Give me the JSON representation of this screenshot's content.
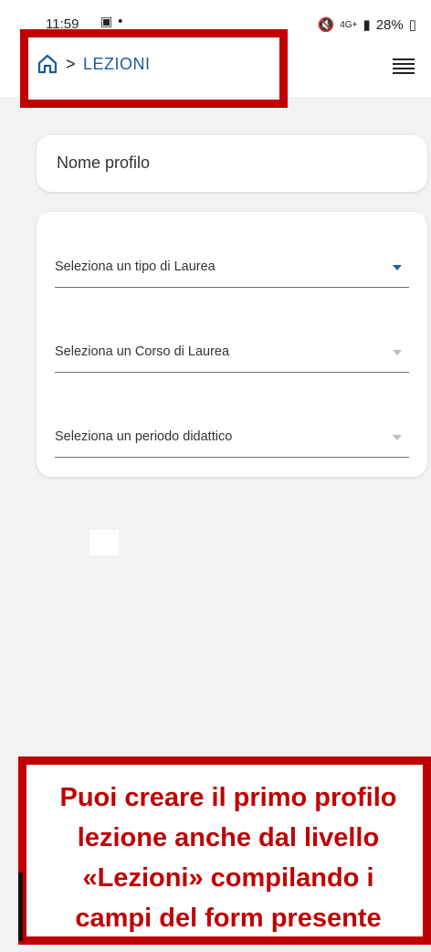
{
  "status": {
    "time": "11:59",
    "left_icons": "▣ •",
    "network": "4G+",
    "battery": "28%",
    "icons": [
      "mute-icon",
      "signal-icon",
      "battery-icon"
    ]
  },
  "header": {
    "breadcrumb_current": "LEZIONI",
    "home_icon": "home-icon",
    "separator": ">",
    "menu_icon": "menu-icon"
  },
  "form": {
    "profile_name_placeholder": "Nome profilo",
    "selects": [
      {
        "label": "Seleziona un tipo di Laurea",
        "active": true
      },
      {
        "label": "Seleziona un Corso di Laurea",
        "active": false
      },
      {
        "label": "Seleziona un periodo didattico",
        "active": false
      }
    ]
  },
  "callout": {
    "lines": [
      "Puoi creare il primo profilo",
      "lezione anche dal livello",
      "«Lezioni» compilando i",
      "campi del form presente"
    ]
  },
  "colors": {
    "accent": "#1d5b9c",
    "annotation_red": "#c00000",
    "background": "#f2f2f2"
  }
}
